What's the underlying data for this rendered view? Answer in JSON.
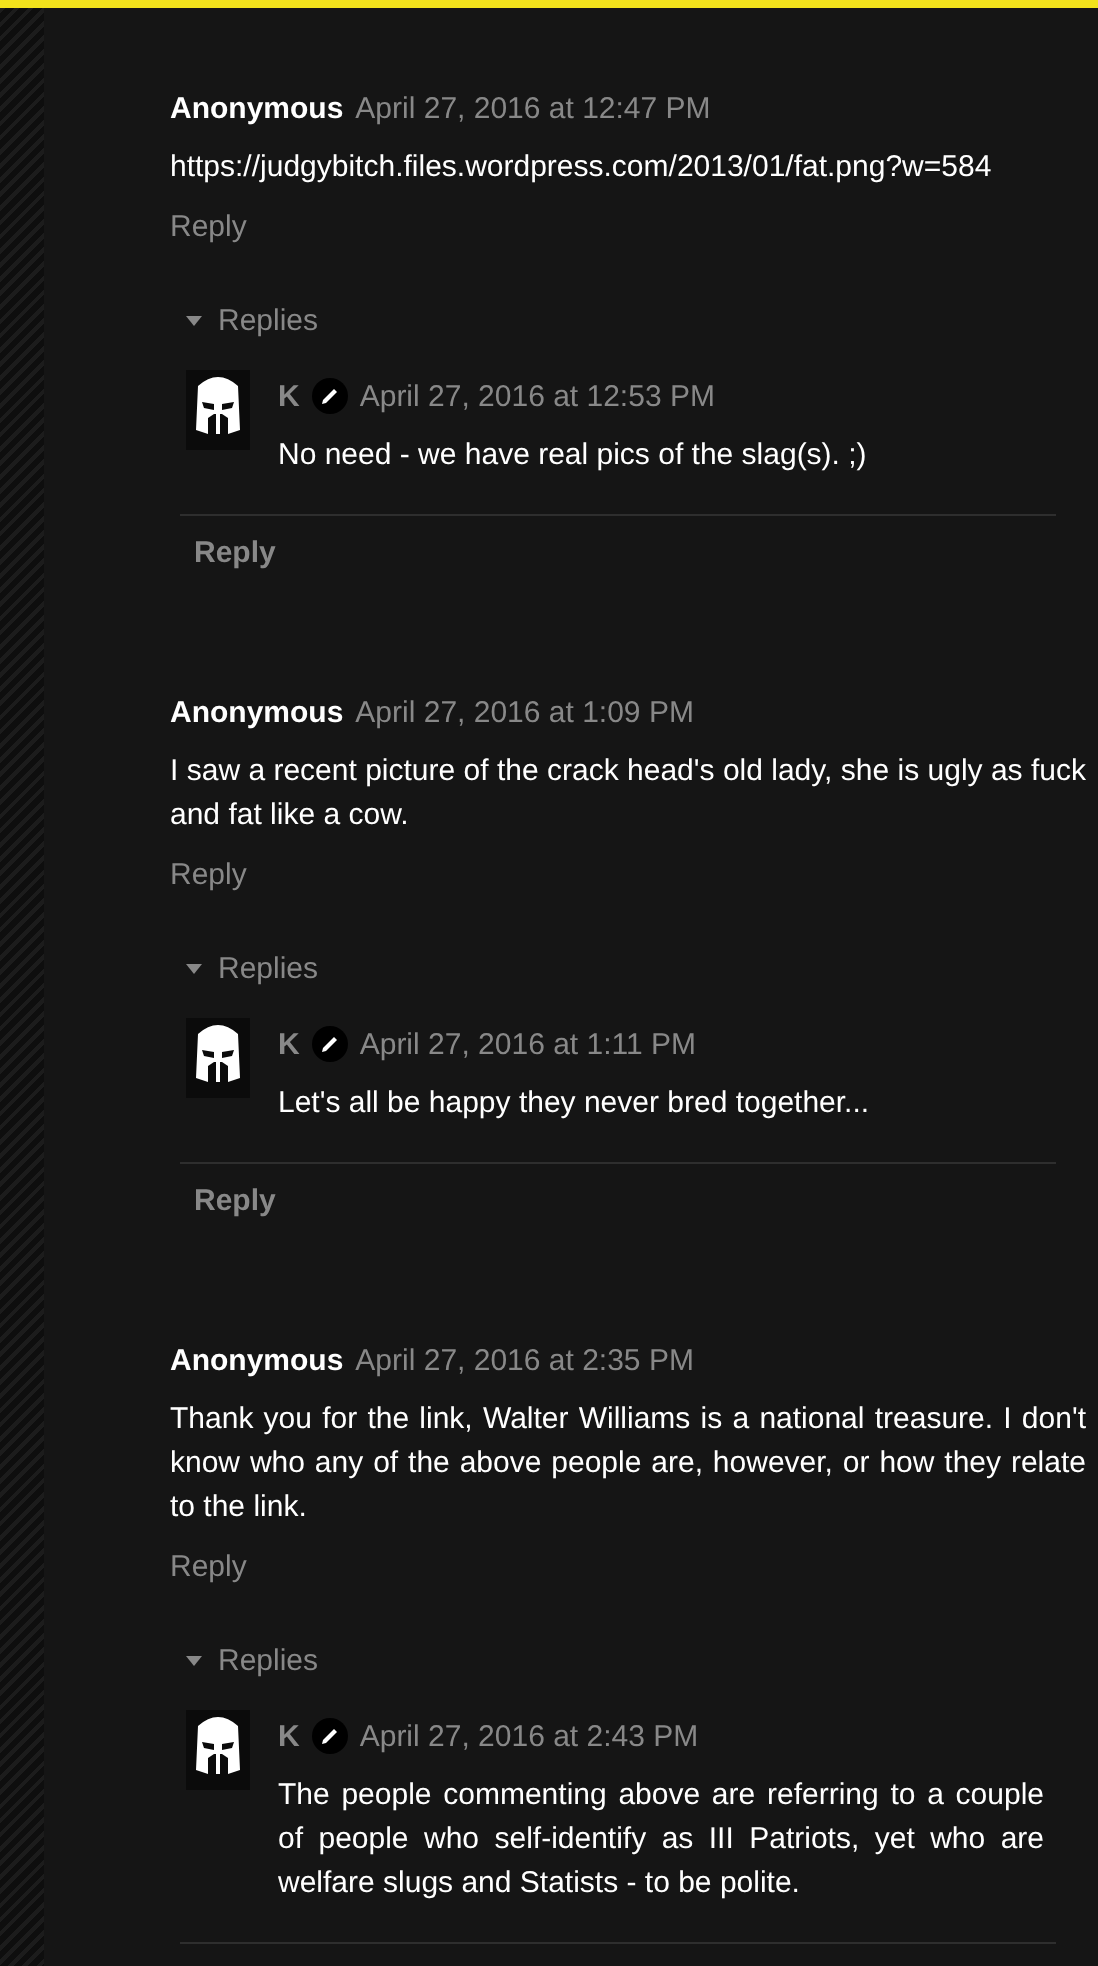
{
  "comments": [
    {
      "author": "Anonymous",
      "date": "April 27, 2016 at 12:47 PM",
      "body": "https://judgybitch.files.wordpress.com/2013/01/fat.png?w=584",
      "reply_label": "Reply",
      "replies_label": "Replies",
      "replies": [
        {
          "author": "K",
          "date": "April 27, 2016 at 12:53 PM",
          "body": "No need - we have real pics of the slag(s). ;)"
        }
      ],
      "thread_reply_label": "Reply"
    },
    {
      "author": "Anonymous",
      "date": "April 27, 2016 at 1:09 PM",
      "body": "I saw a recent picture of the crack head's old lady, she is ugly as fuck and fat like a cow.",
      "reply_label": "Reply",
      "replies_label": "Replies",
      "replies": [
        {
          "author": "K",
          "date": "April 27, 2016 at 1:11 PM",
          "body": "Let's all be happy they never bred together..."
        }
      ],
      "thread_reply_label": "Reply"
    },
    {
      "author": "Anonymous",
      "date": "April 27, 2016 at 2:35 PM",
      "body": "Thank you for the link, Walter Williams is a national treasure. I don't know who any of the above people are, however, or how they relate to the link.",
      "reply_label": "Reply",
      "replies_label": "Replies",
      "replies": [
        {
          "author": "K",
          "date": "April 27, 2016 at 2:43 PM",
          "body": "The people commenting above are referring to a couple of people who self-identify as III Patriots, yet who are welfare slugs and Statists - to be polite."
        }
      ]
    }
  ]
}
